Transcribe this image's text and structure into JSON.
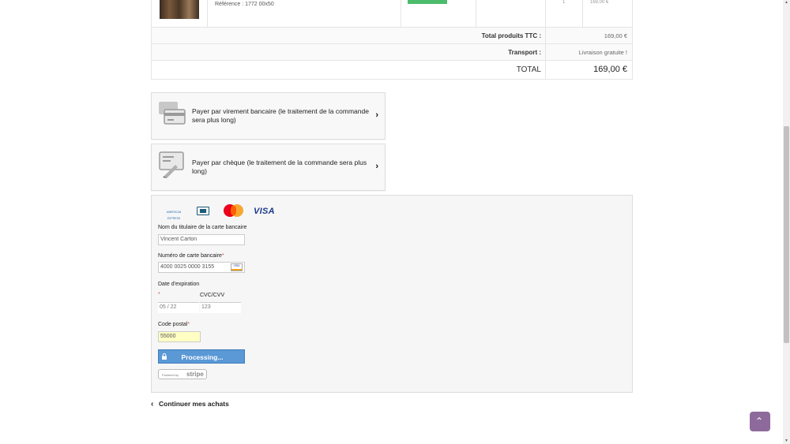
{
  "cart": {
    "reference": "Référence : 1772 00x50",
    "cut_qty": "1",
    "cut_col": "1",
    "cut_price": "169,00 €",
    "total_products_label": "Total produits TTC :",
    "total_products_value": "169,00 €",
    "transport_label": "Transport :",
    "transport_value": "Livraison gratuite !",
    "total_label": "TOTAL",
    "total_value": "169,00 €"
  },
  "payment_options": [
    {
      "label": "Payer par virement bancaire (le traitement de la commande sera plus long)",
      "icon": "bank-transfer-icon"
    },
    {
      "label": "Payer par chèque (le traitement de la commande sera plus long)",
      "icon": "cheque-icon"
    }
  ],
  "stripe": {
    "cards": [
      "amex-icon",
      "diners-icon",
      "mastercard-icon",
      "visa-icon"
    ],
    "visa_text": "VISA",
    "amex_text": "AMERICAN EXPRESS",
    "holder_label": "Nom du titulaire de la carte bancaire",
    "holder_value": "Vincent Carton",
    "number_label": "Numéro de carte bancaire",
    "number_value": "4000 0025 0000 3155",
    "mini_card_text": "VISA",
    "expiry_label": "Date d'expiration",
    "expiry_value": "05 / 22",
    "cvc_label": "CVC/CVV",
    "cvc_value": "123",
    "postal_label": "Code postal",
    "postal_value": "55000",
    "required_mark": "*",
    "processing_label": "Processing...",
    "powered_by": "Powered by",
    "stripe_text": "stripe"
  },
  "continue_label": "Continuer mes achats",
  "colors": {
    "processing_button": "#5a98d6",
    "back_to_top": "#8e6a9c",
    "postal_highlight": "#ffffc4"
  }
}
